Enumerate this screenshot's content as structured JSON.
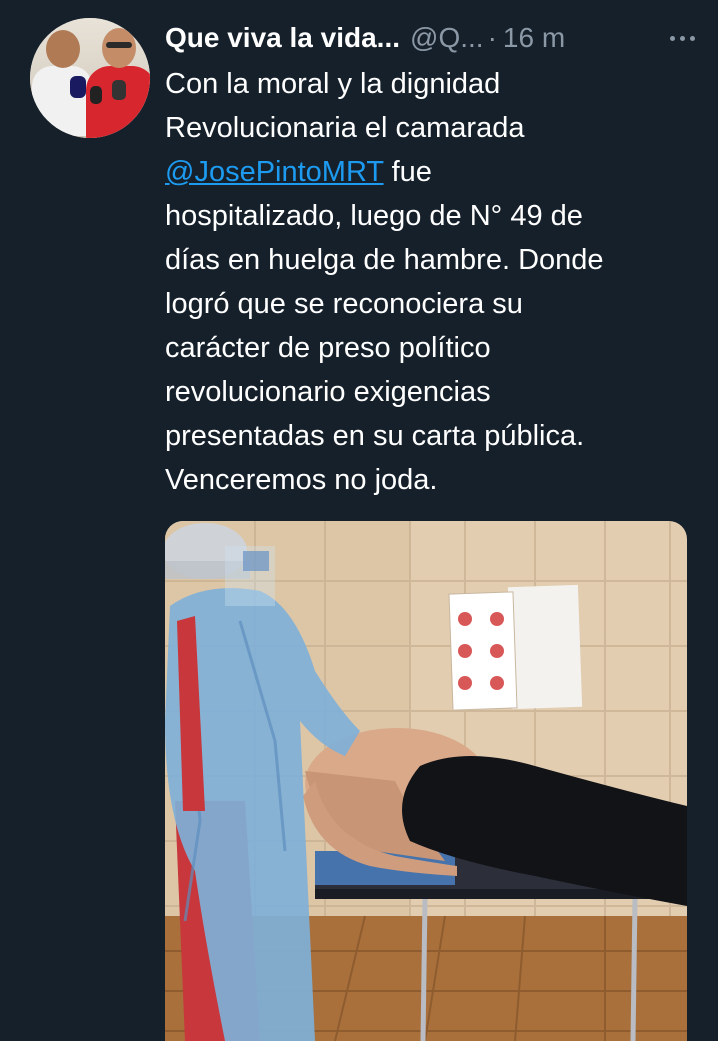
{
  "tweet": {
    "author_name": "Que viva la vida...",
    "handle": "@Q...",
    "separator": "·",
    "time": "16 m",
    "more_icon": "more-horizontal-icon",
    "body": {
      "line1": "Con la moral y la dignidad",
      "line2": "Revolucionaria el camarada",
      "mention": "@JosePintoMRT",
      "line3_rest": " fue",
      "line4": "hospitalizado, luego de N° 49 de",
      "line5": "días en huelga de hambre. Donde",
      "line6": "logró que se reconociera su",
      "line7": "carácter de preso político",
      "line8": "revolucionario exigencias",
      "line9": "presentadas en su carta pública.",
      "line10": "Venceremos no joda."
    }
  },
  "colors": {
    "background": "#15202b",
    "text_primary": "#ffffff",
    "text_secondary": "#8b98a5",
    "link": "#1d9bf0"
  }
}
